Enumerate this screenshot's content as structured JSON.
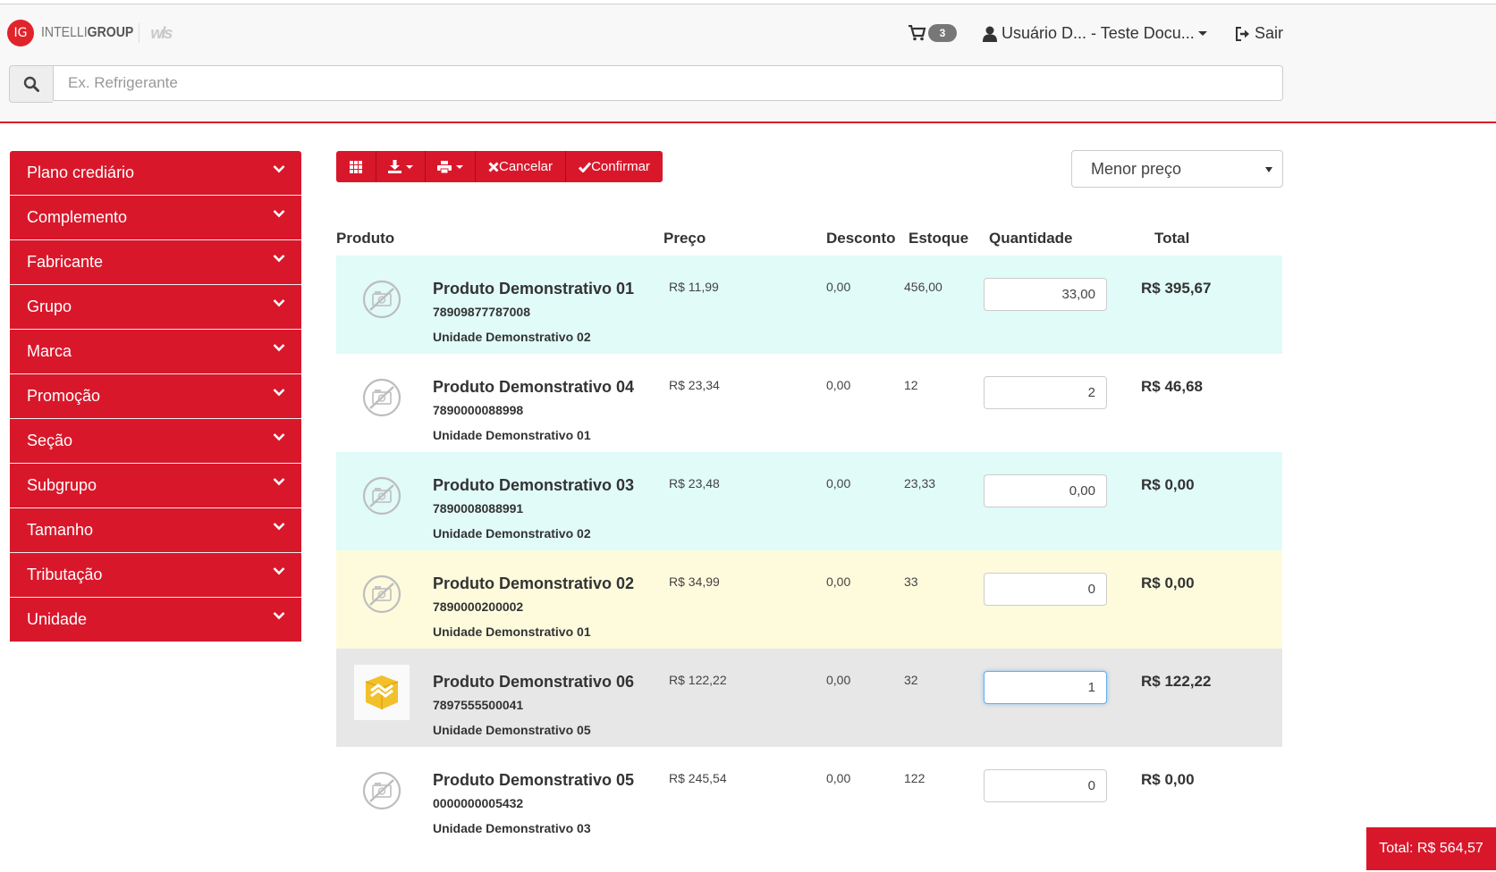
{
  "brand": {
    "badge": "IG",
    "name_light": "INTELLI",
    "name_bold": "GROUP",
    "partner": "wls"
  },
  "header": {
    "cart_count": "3",
    "user_label": "Usuário D... - Teste Docu...",
    "logout_label": "Sair"
  },
  "search": {
    "placeholder": "Ex. Refrigerante"
  },
  "colors": {
    "accent": "#d9172b",
    "row_teal": "#e0fbf8",
    "row_yellow": "#fefbdd",
    "row_gray": "#e7e7e7",
    "row_white": "#ffffff"
  },
  "sidebar": {
    "items": [
      {
        "label": "Plano crediário"
      },
      {
        "label": "Complemento"
      },
      {
        "label": "Fabricante"
      },
      {
        "label": "Grupo"
      },
      {
        "label": "Marca"
      },
      {
        "label": "Promoção"
      },
      {
        "label": "Seção"
      },
      {
        "label": "Subgrupo"
      },
      {
        "label": "Tamanho"
      },
      {
        "label": "Tributação"
      },
      {
        "label": "Unidade"
      }
    ]
  },
  "toolbar": {
    "grid_icon": "grid-icon",
    "download_icon": "download-icon",
    "print_icon": "print-icon",
    "cancel_label": "Cancelar",
    "confirm_label": "Confirmar"
  },
  "sort": {
    "selected": "Menor preço"
  },
  "table": {
    "headers": {
      "produto": "Produto",
      "preco": "Preço",
      "desconto": "Desconto",
      "estoque": "Estoque",
      "quantidade": "Quantidade",
      "total": "Total"
    },
    "rows": [
      {
        "name": "Produto Demonstrativo 01",
        "code": "78909877787008",
        "unit": "Unidade Demonstrativo 02",
        "price": "R$ 11,99",
        "discount": "0,00",
        "stock": "456,00",
        "qty": "33,00",
        "total": "R$ 395,67",
        "bg": "teal",
        "image": "no-image-icon"
      },
      {
        "name": "Produto Demonstrativo 04",
        "code": "7890000088998",
        "unit": "Unidade Demonstrativo 01",
        "price": "R$ 23,34",
        "discount": "0,00",
        "stock": "12",
        "qty": "2",
        "total": "R$ 46,68",
        "bg": "white",
        "image": "no-image-icon"
      },
      {
        "name": "Produto Demonstrativo 03",
        "code": "7890008088991",
        "unit": "Unidade Demonstrativo 02",
        "price": "R$ 23,48",
        "discount": "0,00",
        "stock": "23,33",
        "qty": "0,00",
        "total": "R$ 0,00",
        "bg": "teal",
        "image": "no-image-icon"
      },
      {
        "name": "Produto Demonstrativo 02",
        "code": "7890000200002",
        "unit": "Unidade Demonstrativo 01",
        "price": "R$ 34,99",
        "discount": "0,00",
        "stock": "33",
        "qty": "0",
        "total": "R$ 0,00",
        "bg": "yellow",
        "image": "no-image-icon"
      },
      {
        "name": "Produto Demonstrativo 06",
        "code": "7897555500041",
        "unit": "Unidade Demonstrativo 05",
        "price": "R$ 122,22",
        "discount": "0,00",
        "stock": "32",
        "qty": "1",
        "total": "R$ 122,22",
        "bg": "gray",
        "image": "product-box-icon",
        "focused": true
      },
      {
        "name": "Produto Demonstrativo 05",
        "code": "0000000005432",
        "unit": "Unidade Demonstrativo 03",
        "price": "R$ 245,54",
        "discount": "0,00",
        "stock": "122",
        "qty": "0",
        "total": "R$ 0,00",
        "bg": "white",
        "image": "no-image-icon"
      }
    ]
  },
  "grand_total": "Total: R$ 564,57"
}
